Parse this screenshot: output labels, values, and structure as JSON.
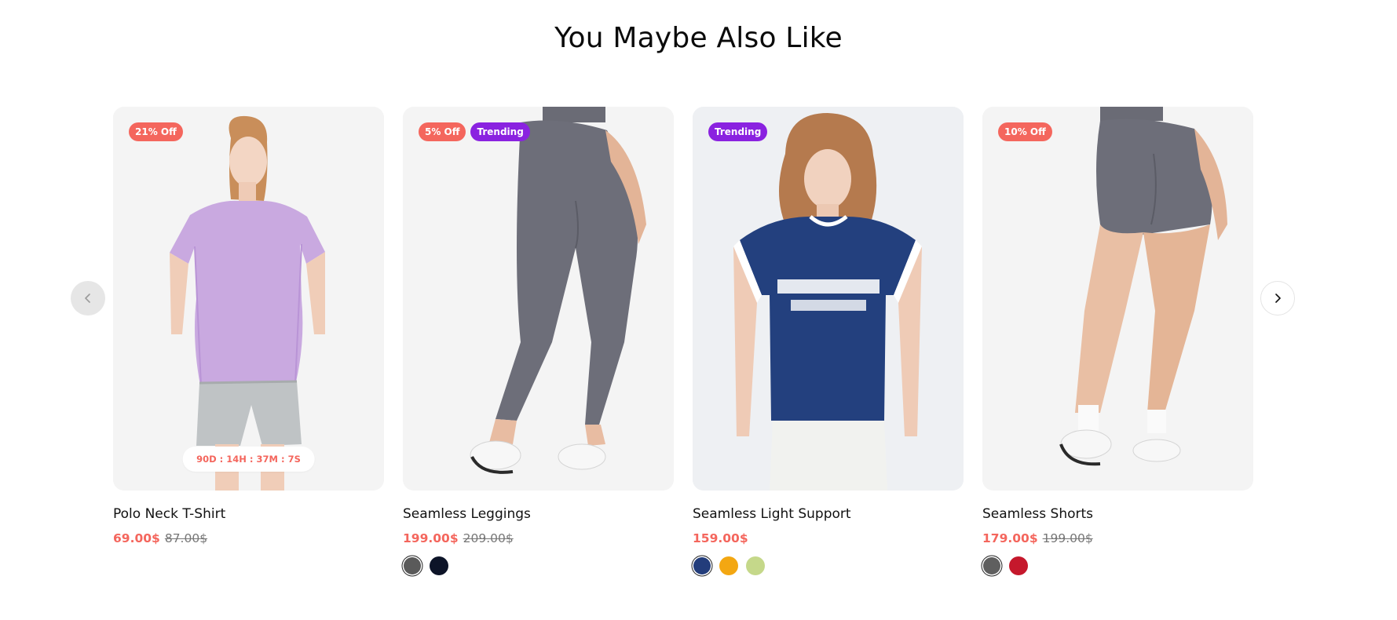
{
  "section": {
    "title": "You Maybe Also Like"
  },
  "products": [
    {
      "name": "Polo Neck T-Shirt",
      "price": "69.00$",
      "old_price": "87.00$",
      "badges": [
        {
          "label": "21% Off",
          "kind": "sale"
        }
      ],
      "countdown": "90D : 14H : 37M : 7S",
      "swatches": []
    },
    {
      "name": "Seamless Leggings",
      "price": "199.00$",
      "old_price": "209.00$",
      "badges": [
        {
          "label": "5% Off",
          "kind": "sale"
        },
        {
          "label": "Trending",
          "kind": "trend"
        }
      ],
      "swatches": [
        {
          "color": "#5a5a5a",
          "active": true
        },
        {
          "color": "#0d1428",
          "active": false
        }
      ]
    },
    {
      "name": "Seamless Light Support",
      "price": "159.00$",
      "old_price": "",
      "badges": [
        {
          "label": "Trending",
          "kind": "trend"
        }
      ],
      "swatches": [
        {
          "color": "#233d7b",
          "active": true
        },
        {
          "color": "#f3a712",
          "active": false
        },
        {
          "color": "#c5d88a",
          "active": false
        }
      ]
    },
    {
      "name": "Seamless Shorts",
      "price": "179.00$",
      "old_price": "199.00$",
      "badges": [
        {
          "label": "10% Off",
          "kind": "sale"
        }
      ],
      "swatches": [
        {
          "color": "#5f5f5f",
          "active": true
        },
        {
          "color": "#c5182c",
          "active": false
        }
      ]
    }
  ],
  "colors": {
    "sale": "#f4665d",
    "trend": "#8a22e0",
    "price": "#f4665d"
  },
  "icons": {
    "prev": "chevron-left-icon",
    "next": "chevron-right-icon"
  }
}
